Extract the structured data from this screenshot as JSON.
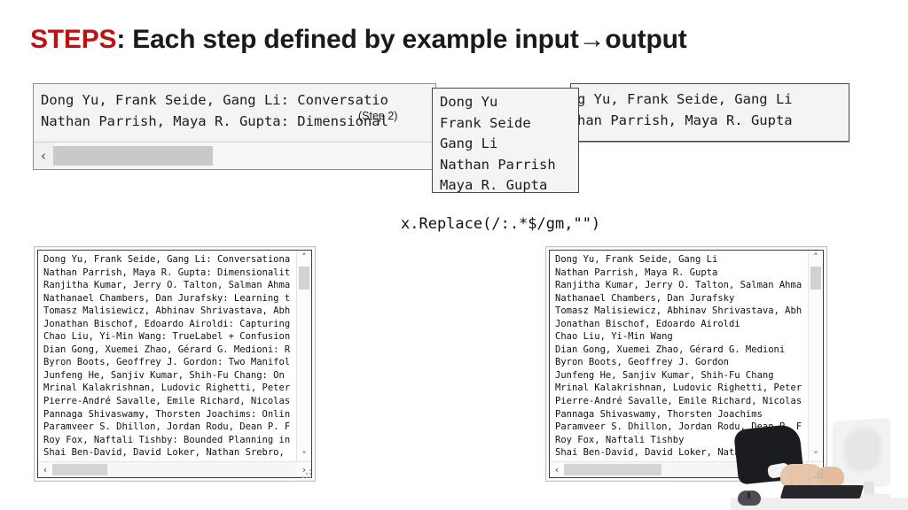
{
  "slide": {
    "title_keyword": "STEPS",
    "title_rest": ": Each step defined by example input→output"
  },
  "step_badge": {
    "label": "(Step 2)"
  },
  "transform": {
    "expression": "x.Replace(/:.*$/gm,\"\")"
  },
  "top_input_panel": {
    "name": "input-text-box",
    "lines": [
      "Dong Yu, Frank Seide, Gang Li: Conversatio",
      "Nathan Parrish, Maya R. Gupta: Dimensional"
    ],
    "hscroll": {
      "left_arrow": "‹",
      "right_arrow": "›"
    }
  },
  "step_popup": {
    "name": "step-result-popup",
    "lines": [
      "Dong Yu",
      "Frank Seide",
      "Gang Li",
      "Nathan Parrish",
      "Maya R. Gupta"
    ]
  },
  "top_output_panel": {
    "name": "output-text-box",
    "lines": [
      "g Yu, Frank Seide, Gang Li",
      "han Parrish, Maya R. Gupta"
    ]
  },
  "bottom_left_panel": {
    "title": "input-list",
    "lines": [
      "Dong Yu, Frank Seide, Gang Li: Conversationa",
      "Nathan Parrish, Maya R. Gupta: Dimensionalit",
      "Ranjitha Kumar, Jerry O. Talton, Salman Ahma",
      "Nathanael Chambers, Dan Jurafsky: Learning t",
      "Tomasz Malisiewicz, Abhinav Shrivastava, Abh",
      "Jonathan Bischof, Edoardo Airoldi: Capturing",
      "Chao Liu, Yi-Min Wang: TrueLabel + Confusion",
      "Dian Gong, Xuemei Zhao, Gérard G. Medioni: R",
      "Byron Boots, Geoffrey J. Gordon: Two Manifol",
      "Junfeng He, Sanjiv Kumar, Shih-Fu Chang: On",
      "Mrinal Kalakrishnan, Ludovic Righetti, Peter",
      "Pierre-André Savalle, Emile Richard, Nicolas",
      "Pannaga Shivaswamy, Thorsten Joachims: Onlin",
      "Paramveer S. Dhillon, Jordan Rodu, Dean P. F",
      "Roy Fox, Naftali Tishby: Bounded Planning in",
      "Shai Ben-David, David Loker, Nathan Srebro,"
    ],
    "vscroll": {
      "up_arrow": "˄",
      "down_arrow": "˅"
    },
    "hscroll": {
      "left_arrow": "‹",
      "right_arrow": "›"
    }
  },
  "bottom_right_panel": {
    "title": "output-list",
    "lines": [
      "Dong Yu, Frank Seide, Gang Li",
      "Nathan Parrish, Maya R. Gupta",
      "Ranjitha Kumar, Jerry O. Talton, Salman Ahma",
      "Nathanael Chambers, Dan Jurafsky",
      "Tomasz Malisiewicz, Abhinav Shrivastava, Abh",
      "Jonathan Bischof, Edoardo Airoldi",
      "Chao Liu, Yi-Min Wang",
      "Dian Gong, Xuemei Zhao, Gérard G. Medioni",
      "Byron Boots, Geoffrey J. Gordon",
      "Junfeng He, Sanjiv Kumar, Shih-Fu Chang",
      "Mrinal Kalakrishnan, Ludovic Righetti, Peter",
      "Pierre-André Savalle, Emile Richard, Nicolas",
      "Pannaga Shivaswamy, Thorsten Joachims",
      "Paramveer S. Dhillon, Jordan Rodu, Dean P. F",
      "Roy Fox, Naftali Tishby",
      "Shai Ben-David, David Loker, Nathan Srebro,"
    ],
    "vscroll": {
      "up_arrow": "˄",
      "down_arrow": "˅"
    },
    "hscroll": {
      "left_arrow": "‹",
      "right_arrow": "›"
    }
  },
  "colors": {
    "title_accent": "#BE1212",
    "text": "#1c1c1c",
    "panel_bg": "#f4f4f4",
    "panel_border": "#4a4a4a",
    "scroll_thumb": "#c9c9c9"
  }
}
